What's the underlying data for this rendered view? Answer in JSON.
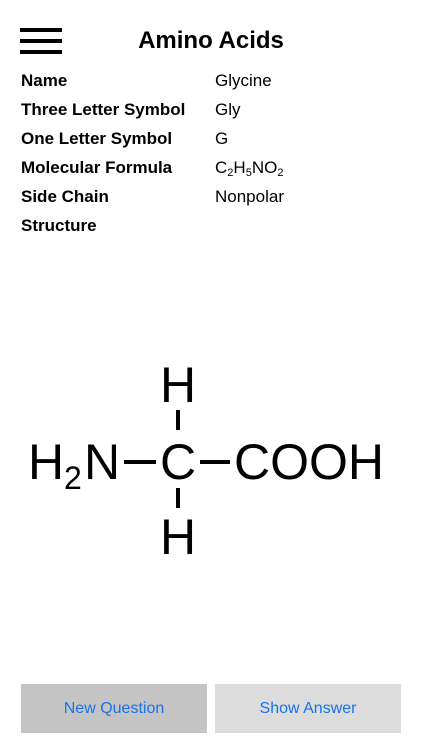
{
  "header": {
    "title": "Amino Acids",
    "menu_icon": "hamburger-menu-icon"
  },
  "info": {
    "rows": [
      {
        "label": "Name",
        "value": "Glycine"
      },
      {
        "label": "Three Letter Symbol",
        "value": "Gly"
      },
      {
        "label": "One Letter Symbol",
        "value": "G"
      },
      {
        "label": "Molecular Formula",
        "value": "C2H5NO2"
      },
      {
        "label": "Side Chain",
        "value": "Nonpolar"
      }
    ],
    "structure_label": "Structure",
    "formula_parts": {
      "c": "C",
      "c_sub": "2",
      "h": "H",
      "h_sub": "5",
      "n": "NO",
      "o_sub": "2"
    }
  },
  "structure": {
    "top_h": "H",
    "bottom_h": "H",
    "left_group": "H",
    "left_group_sub": "2",
    "left_group_tail": "N",
    "center": "C",
    "right_group": "COOH"
  },
  "buttons": {
    "new_question": "New Question",
    "show_answer": "Show Answer"
  },
  "colors": {
    "button_text": "#1a73e8",
    "new_question_bg": "#c4c4c4",
    "show_answer_bg": "#dcdcdc"
  }
}
